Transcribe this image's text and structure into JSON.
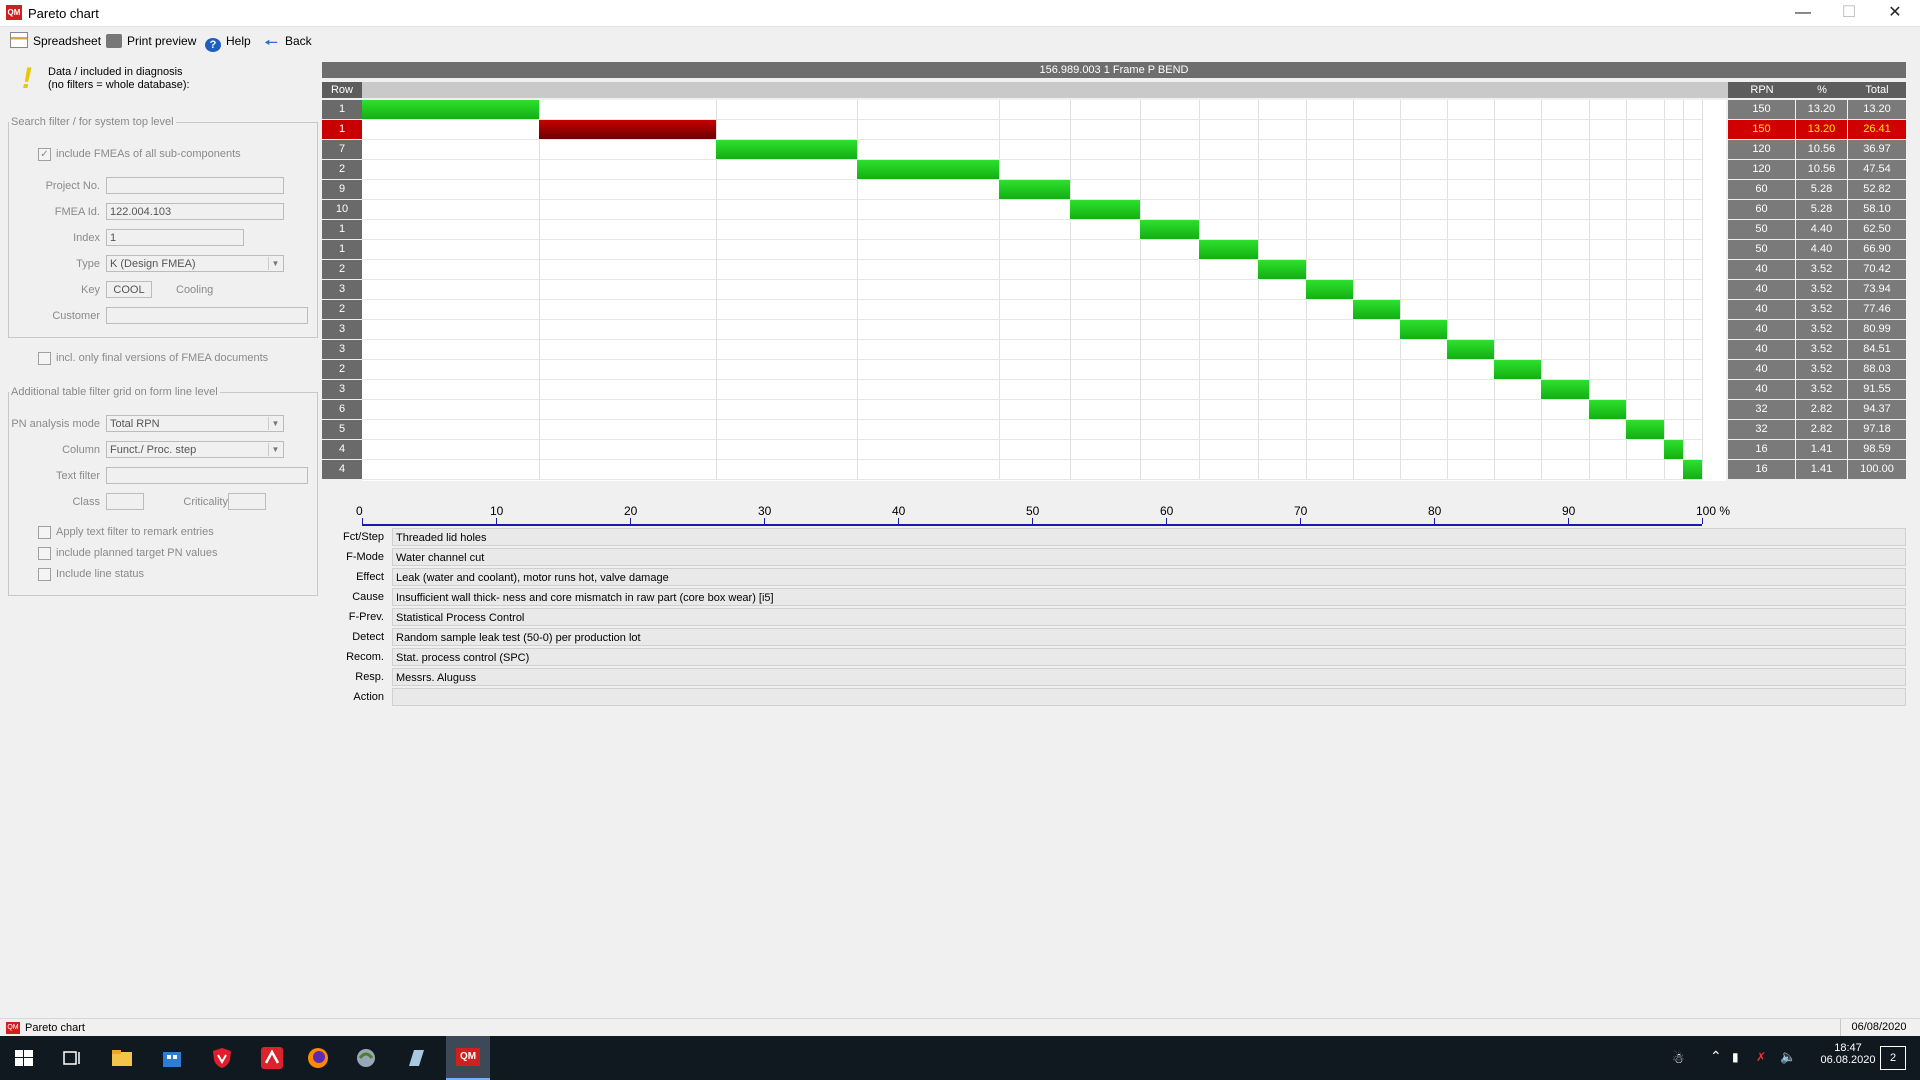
{
  "window": {
    "title": "Pareto chart",
    "app_icon_text": "QM"
  },
  "toolbar": {
    "spreadsheet": "Spreadsheet",
    "print_preview": "Print preview",
    "help": "Help",
    "back": "Back"
  },
  "left_panel": {
    "info_line1": "Data / included in diagnosis",
    "info_line2": "(no filters = whole database):",
    "search_filter": {
      "legend": "Search filter / for system top level",
      "include_fmeas": "include FMEAs of all sub-components",
      "include_fmeas_checked": true,
      "project_no_label": "Project No.",
      "project_no_value": "",
      "fmea_id_label": "FMEA Id.",
      "fmea_id_value": "122.004.103",
      "index_label": "Index",
      "index_value": "1",
      "type_label": "Type",
      "type_value": "K (Design FMEA)",
      "key_label": "Key",
      "key_value": "COOL",
      "key_desc": "Cooling",
      "customer_label": "Customer",
      "customer_value": ""
    },
    "final_versions": "incl. only final versions of FMEA documents",
    "additional_filter": {
      "legend": "Additional table filter grid on form line level",
      "pn_mode_label": "PN analysis mode",
      "pn_mode_value": "Total RPN",
      "column_label": "Column",
      "column_value": "Funct./ Proc. step",
      "text_filter_label": "Text filter",
      "text_filter_value": "",
      "class_label": "Class",
      "criticality_label": "Criticality",
      "apply_text_filter": "Apply text filter to remark entries",
      "include_planned": "include planned target PN values",
      "include_line_status": "Include line status"
    }
  },
  "chart_header": "156.989.003  1  Frame  P  BEND",
  "chart_data": {
    "type": "bar",
    "orientation": "horizontal-pareto",
    "columns": {
      "row": "Row",
      "rpn": "RPN",
      "pct": "%",
      "total": "Total"
    },
    "selected_index": 1,
    "rows": [
      {
        "row": "1",
        "rpn": 150,
        "pct": "13.20",
        "total": "13.20"
      },
      {
        "row": "1",
        "rpn": 150,
        "pct": "13.20",
        "total": "26.41"
      },
      {
        "row": "7",
        "rpn": 120,
        "pct": "10.56",
        "total": "36.97"
      },
      {
        "row": "2",
        "rpn": 120,
        "pct": "10.56",
        "total": "47.54"
      },
      {
        "row": "9",
        "rpn": 60,
        "pct": "5.28",
        "total": "52.82"
      },
      {
        "row": "10",
        "rpn": 60,
        "pct": "5.28",
        "total": "58.10"
      },
      {
        "row": "1",
        "rpn": 50,
        "pct": "4.40",
        "total": "62.50"
      },
      {
        "row": "1",
        "rpn": 50,
        "pct": "4.40",
        "total": "66.90"
      },
      {
        "row": "2",
        "rpn": 40,
        "pct": "3.52",
        "total": "70.42"
      },
      {
        "row": "3",
        "rpn": 40,
        "pct": "3.52",
        "total": "73.94"
      },
      {
        "row": "2",
        "rpn": 40,
        "pct": "3.52",
        "total": "77.46"
      },
      {
        "row": "3",
        "rpn": 40,
        "pct": "3.52",
        "total": "80.99"
      },
      {
        "row": "3",
        "rpn": 40,
        "pct": "3.52",
        "total": "84.51"
      },
      {
        "row": "2",
        "rpn": 40,
        "pct": "3.52",
        "total": "88.03"
      },
      {
        "row": "3",
        "rpn": 40,
        "pct": "3.52",
        "total": "91.55"
      },
      {
        "row": "6",
        "rpn": 32,
        "pct": "2.82",
        "total": "94.37"
      },
      {
        "row": "5",
        "rpn": 32,
        "pct": "2.82",
        "total": "97.18"
      },
      {
        "row": "4",
        "rpn": 16,
        "pct": "1.41",
        "total": "98.59"
      },
      {
        "row": "4",
        "rpn": 16,
        "pct": "1.41",
        "total": "100.00"
      }
    ],
    "x_ticks": [
      "0",
      "10",
      "20",
      "30",
      "40",
      "50",
      "60",
      "70",
      "80",
      "90",
      "100 %"
    ],
    "xlim": [
      0,
      100
    ],
    "bar_color": "#22cc22",
    "selected_color": "#c00000"
  },
  "details": [
    {
      "label": "Fct/Step",
      "value": "Threaded lid holes"
    },
    {
      "label": "F-Mode",
      "value": "Water channel cut"
    },
    {
      "label": "Effect",
      "value": "Leak (water and coolant), motor runs hot, valve  damage"
    },
    {
      "label": "Cause",
      "value": "Insufficient wall thick- ness and core mismatch in raw part (core box wear) [i5]"
    },
    {
      "label": "F-Prev.",
      "value": "Statistical Process Control"
    },
    {
      "label": "Detect",
      "value": "Random sample leak test (50-0) per production lot"
    },
    {
      "label": "Recom.",
      "value": "Stat. process control (SPC)"
    },
    {
      "label": "Resp.",
      "value": "Messrs. Aluguss"
    },
    {
      "label": "Action",
      "value": ""
    }
  ],
  "statusbar": {
    "left": "Pareto chart",
    "date": "06/08/2020"
  },
  "taskbar": {
    "time": "18:47",
    "date": "06.08.2020",
    "notifications": "2",
    "qm_label": "QM"
  }
}
